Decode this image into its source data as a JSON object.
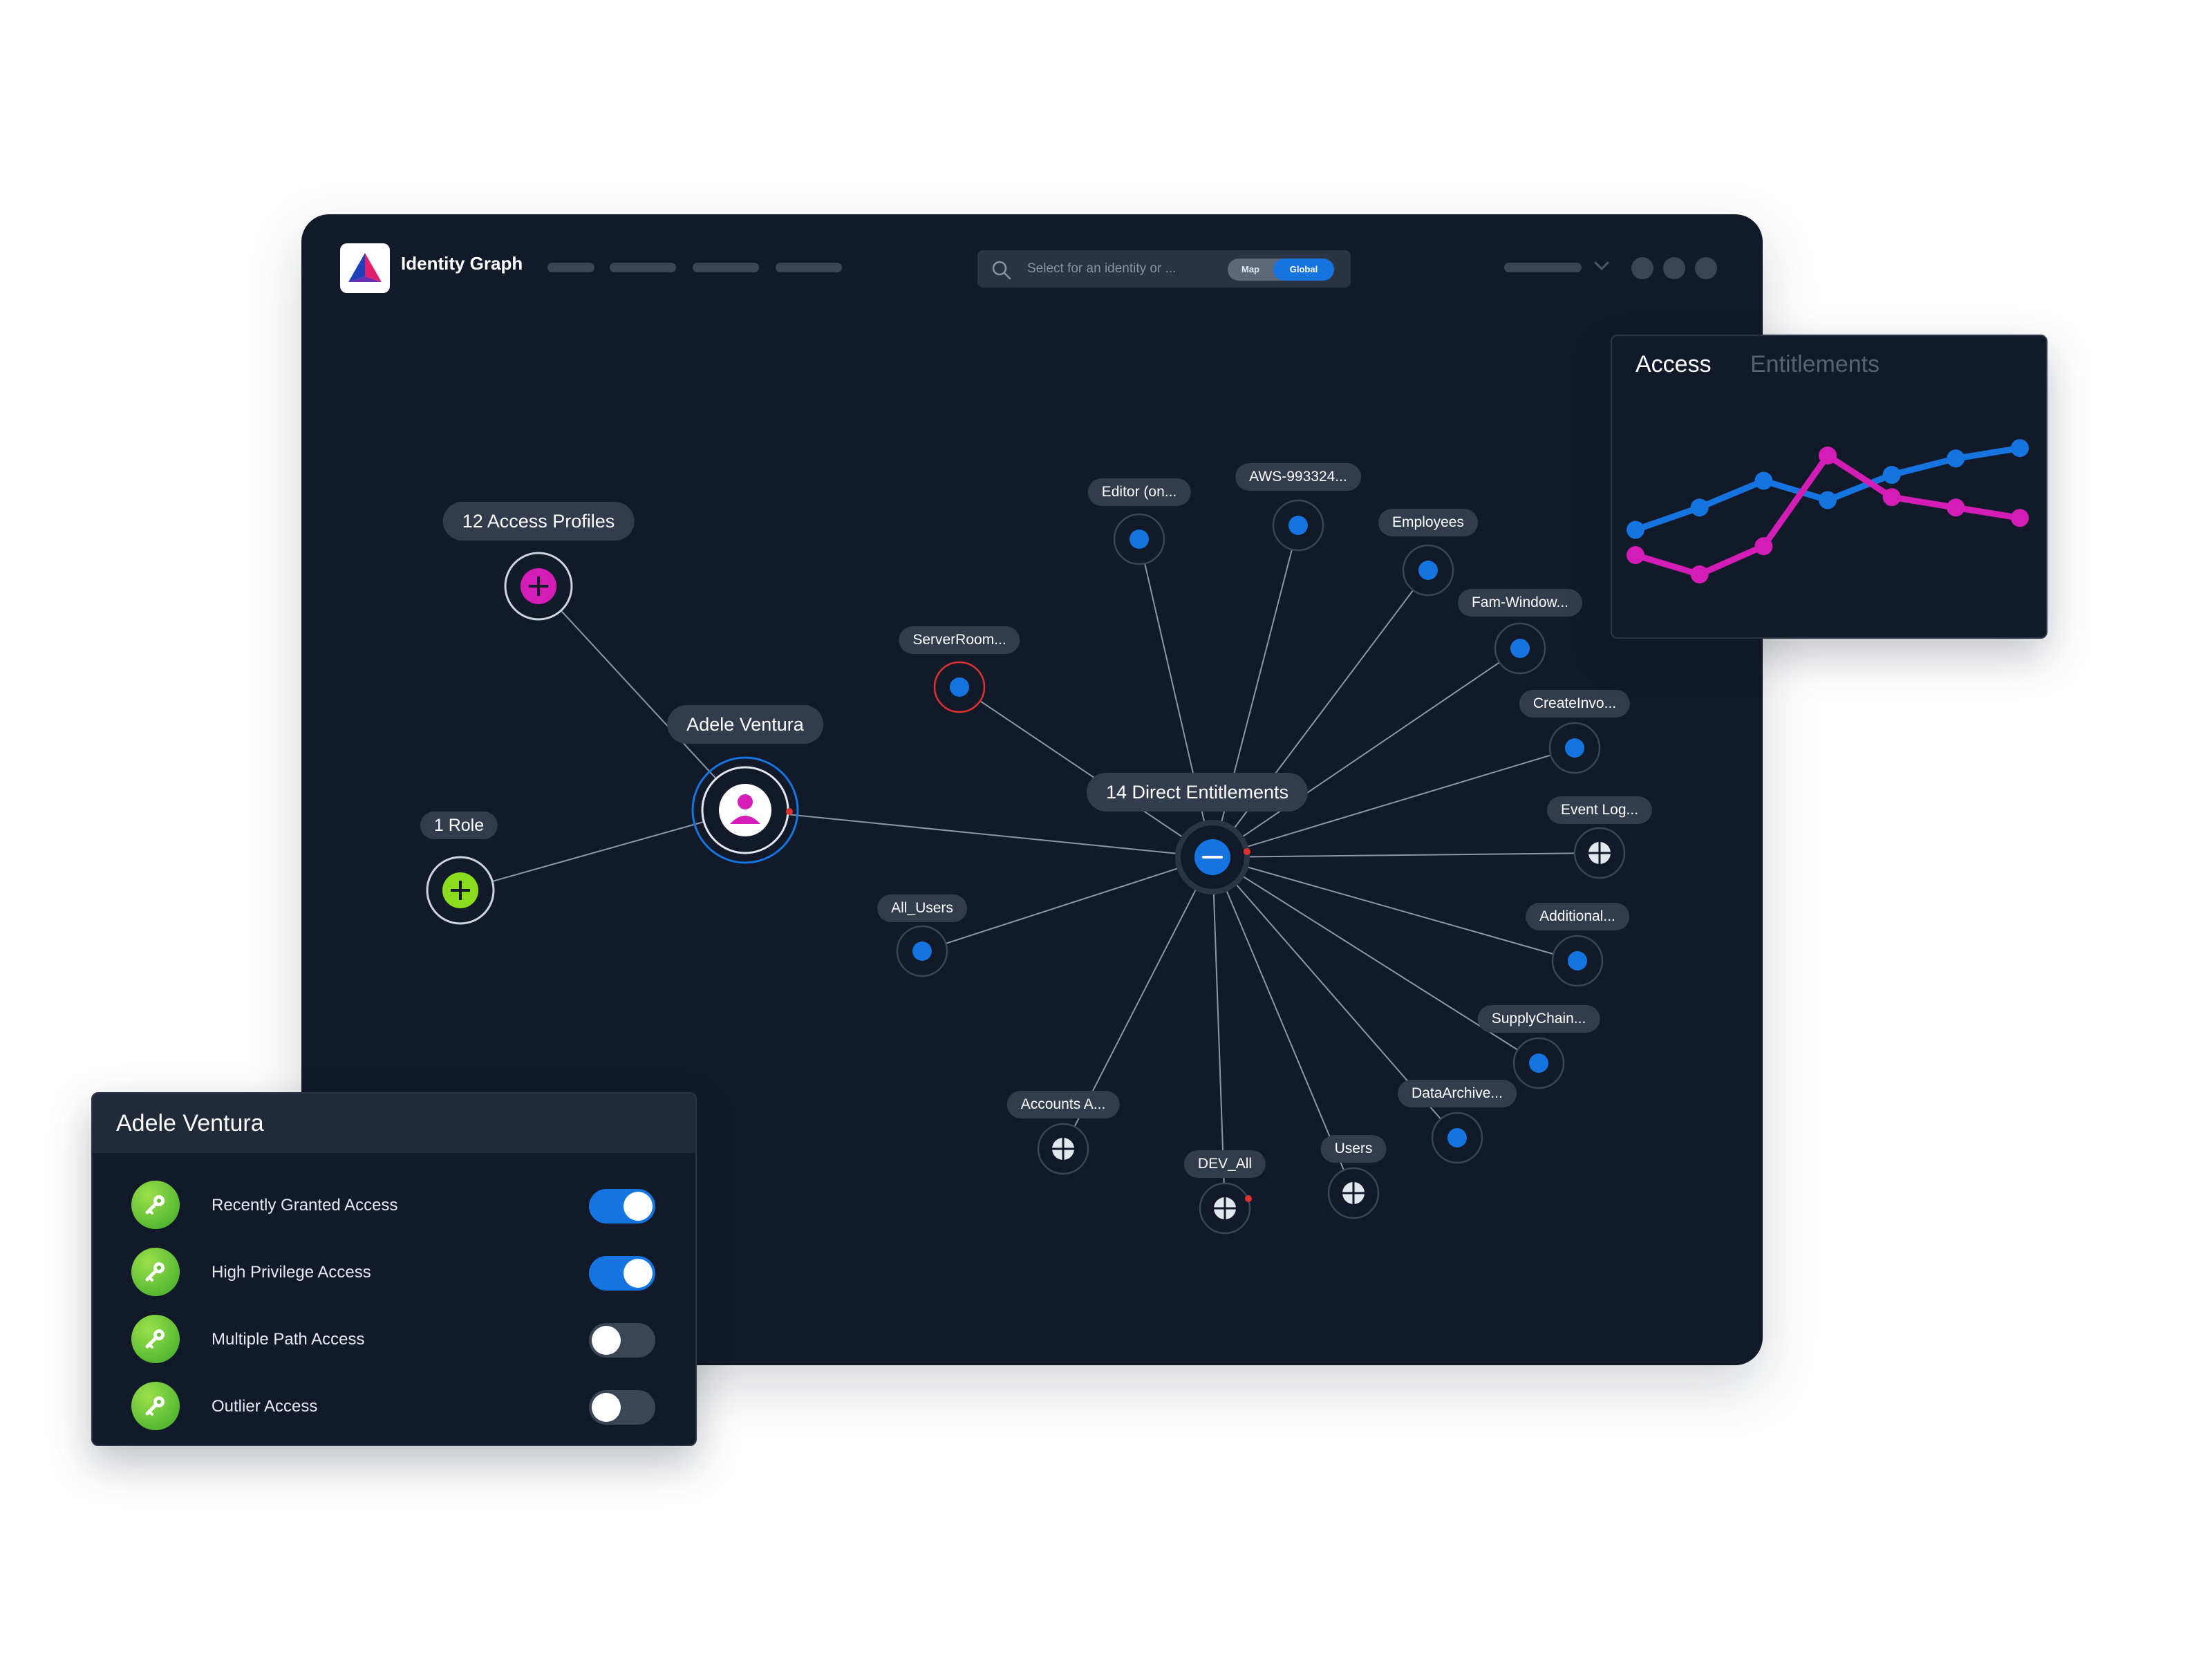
{
  "app": {
    "title": "Identity Graph"
  },
  "search": {
    "placeholder": "Select for an identity or ...",
    "mode_map": "Map",
    "mode_global": "Global"
  },
  "colors": {
    "background": "#121a29",
    "accent_blue": "#1574e0",
    "magenta": "#d41cb6",
    "green": "#8bdc1e",
    "red": "#e03131"
  },
  "graph": {
    "identity_label": "Adele Ventura",
    "access_profiles_label": "12 Access Profiles",
    "role_label": "1 Role",
    "entitlements_label": "14 Direct Entitlements",
    "entitlements": [
      {
        "label": "Editor (on...",
        "icon": "dot"
      },
      {
        "label": "AWS-993324...",
        "icon": "dot"
      },
      {
        "label": "Employees",
        "icon": "dot"
      },
      {
        "label": "Fam-Window...",
        "icon": "dot"
      },
      {
        "label": "CreateInvo...",
        "icon": "dot"
      },
      {
        "label": "Event Log...",
        "icon": "crosshair"
      },
      {
        "label": "Additional...",
        "icon": "dot"
      },
      {
        "label": "SupplyChain...",
        "icon": "dot"
      },
      {
        "label": "DataArchive...",
        "icon": "dot"
      },
      {
        "label": "Users",
        "icon": "crosshair"
      },
      {
        "label": "DEV_All",
        "icon": "crosshair"
      },
      {
        "label": "Accounts A...",
        "icon": "crosshair"
      },
      {
        "label": "All_Users",
        "icon": "dot"
      },
      {
        "label": "ServerRoom...",
        "icon": "dot-flagged"
      }
    ]
  },
  "access_panel": {
    "tabs": [
      "Access",
      "Entitlements"
    ],
    "active_tab": "Access",
    "chart_data": {
      "type": "line",
      "x": [
        1,
        2,
        3,
        4,
        5,
        6,
        7
      ],
      "series": [
        {
          "values": [
            3.0,
            4.5,
            6.3,
            5.0,
            6.7,
            7.8,
            8.5
          ],
          "color": "#1574e0"
        },
        {
          "values": [
            1.3,
            0.0,
            1.9,
            8.0,
            5.2,
            4.5,
            3.8
          ],
          "color": "#d41cb6"
        }
      ],
      "ylim": [
        0,
        10
      ],
      "grid": false,
      "legend": "none"
    }
  },
  "identity_panel": {
    "title": "Adele Ventura",
    "rows": [
      {
        "label": "Recently Granted Access",
        "enabled": true
      },
      {
        "label": "High Privilege Access",
        "enabled": true
      },
      {
        "label": "Multiple Path Access",
        "enabled": false
      },
      {
        "label": "Outlier Access",
        "enabled": false
      }
    ]
  }
}
